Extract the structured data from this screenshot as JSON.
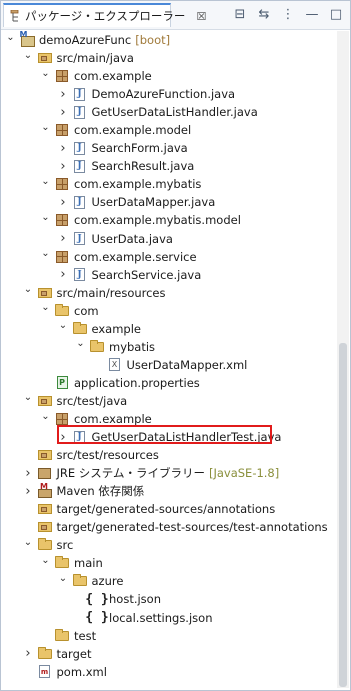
{
  "view": {
    "tab_label": "パッケージ・エクスプローラー",
    "tab_close": "☒"
  },
  "toolbar": {
    "collapse_all": "⊟",
    "link_editor": "⇆",
    "focus": "⋮",
    "minimize": "—",
    "maximize": "□"
  },
  "tree": [
    {
      "label": "demoAzureFunc",
      "decor": "[boot]",
      "arrow": "open",
      "icon": "project",
      "indent": 0
    },
    {
      "label": "src/main/java",
      "arrow": "open",
      "icon": "srcfolder",
      "indent": 1
    },
    {
      "label": "com.example",
      "arrow": "open",
      "icon": "package",
      "indent": 2
    },
    {
      "label": "DemoAzureFunction.java",
      "arrow": "closed",
      "icon": "java",
      "indent": 3
    },
    {
      "label": "GetUserDataListHandler.java",
      "arrow": "closed",
      "icon": "java",
      "indent": 3
    },
    {
      "label": "com.example.model",
      "arrow": "open",
      "icon": "package",
      "indent": 2
    },
    {
      "label": "SearchForm.java",
      "arrow": "closed",
      "icon": "java",
      "indent": 3
    },
    {
      "label": "SearchResult.java",
      "arrow": "closed",
      "icon": "java",
      "indent": 3
    },
    {
      "label": "com.example.mybatis",
      "arrow": "open",
      "icon": "package",
      "indent": 2
    },
    {
      "label": "UserDataMapper.java",
      "arrow": "closed",
      "icon": "java",
      "indent": 3
    },
    {
      "label": "com.example.mybatis.model",
      "arrow": "open",
      "icon": "package",
      "indent": 2
    },
    {
      "label": "UserData.java",
      "arrow": "closed",
      "icon": "java",
      "indent": 3
    },
    {
      "label": "com.example.service",
      "arrow": "open",
      "icon": "package",
      "indent": 2
    },
    {
      "label": "SearchService.java",
      "arrow": "closed",
      "icon": "java",
      "indent": 3
    },
    {
      "label": "src/main/resources",
      "arrow": "open",
      "icon": "srcfolder",
      "indent": 1
    },
    {
      "label": "com",
      "arrow": "open",
      "icon": "folder",
      "indent": 2
    },
    {
      "label": "example",
      "arrow": "open",
      "icon": "folder",
      "indent": 3
    },
    {
      "label": "mybatis",
      "arrow": "open",
      "icon": "folder",
      "indent": 4
    },
    {
      "label": "UserDataMapper.xml",
      "arrow": "none",
      "icon": "xml",
      "indent": 5
    },
    {
      "label": "application.properties",
      "arrow": "none",
      "icon": "properties",
      "indent": 2
    },
    {
      "label": "src/test/java",
      "arrow": "open",
      "icon": "srcfolder",
      "indent": 1
    },
    {
      "label": "com.example",
      "arrow": "open",
      "icon": "package",
      "indent": 2
    },
    {
      "label": "GetUserDataListHandlerTest.java",
      "arrow": "closed",
      "icon": "java",
      "indent": 3
    },
    {
      "label": "src/test/resources",
      "arrow": "none",
      "icon": "srcfolder",
      "indent": 1
    },
    {
      "label": "JRE システム・ライブラリー",
      "jre": "[JavaSE-1.8]",
      "arrow": "closed",
      "icon": "library",
      "indent": 1
    },
    {
      "label": "Maven 依存関係",
      "arrow": "closed",
      "icon": "maven",
      "indent": 1
    },
    {
      "label": "target/generated-sources/annotations",
      "arrow": "none",
      "icon": "srcfolder",
      "indent": 1
    },
    {
      "label": "target/generated-test-sources/test-annotations",
      "arrow": "none",
      "icon": "srcfolder",
      "indent": 1
    },
    {
      "label": "src",
      "arrow": "open",
      "icon": "folder",
      "indent": 1
    },
    {
      "label": "main",
      "arrow": "open",
      "icon": "folder",
      "indent": 2
    },
    {
      "label": "azure",
      "arrow": "open",
      "icon": "folder",
      "indent": 3
    },
    {
      "label": "host.json",
      "arrow": "none",
      "icon": "json",
      "indent": 4
    },
    {
      "label": "local.settings.json",
      "arrow": "none",
      "icon": "json",
      "indent": 4
    },
    {
      "label": "test",
      "arrow": "none",
      "icon": "folder",
      "indent": 2
    },
    {
      "label": "target",
      "arrow": "closed",
      "icon": "folder",
      "indent": 1
    },
    {
      "label": "pom.xml",
      "arrow": "none",
      "icon": "pom",
      "indent": 1
    }
  ],
  "colors": {
    "highlight_box": "#e11b1b",
    "decor": "#a07a3a",
    "jre_decor": "#8a8f3b"
  }
}
